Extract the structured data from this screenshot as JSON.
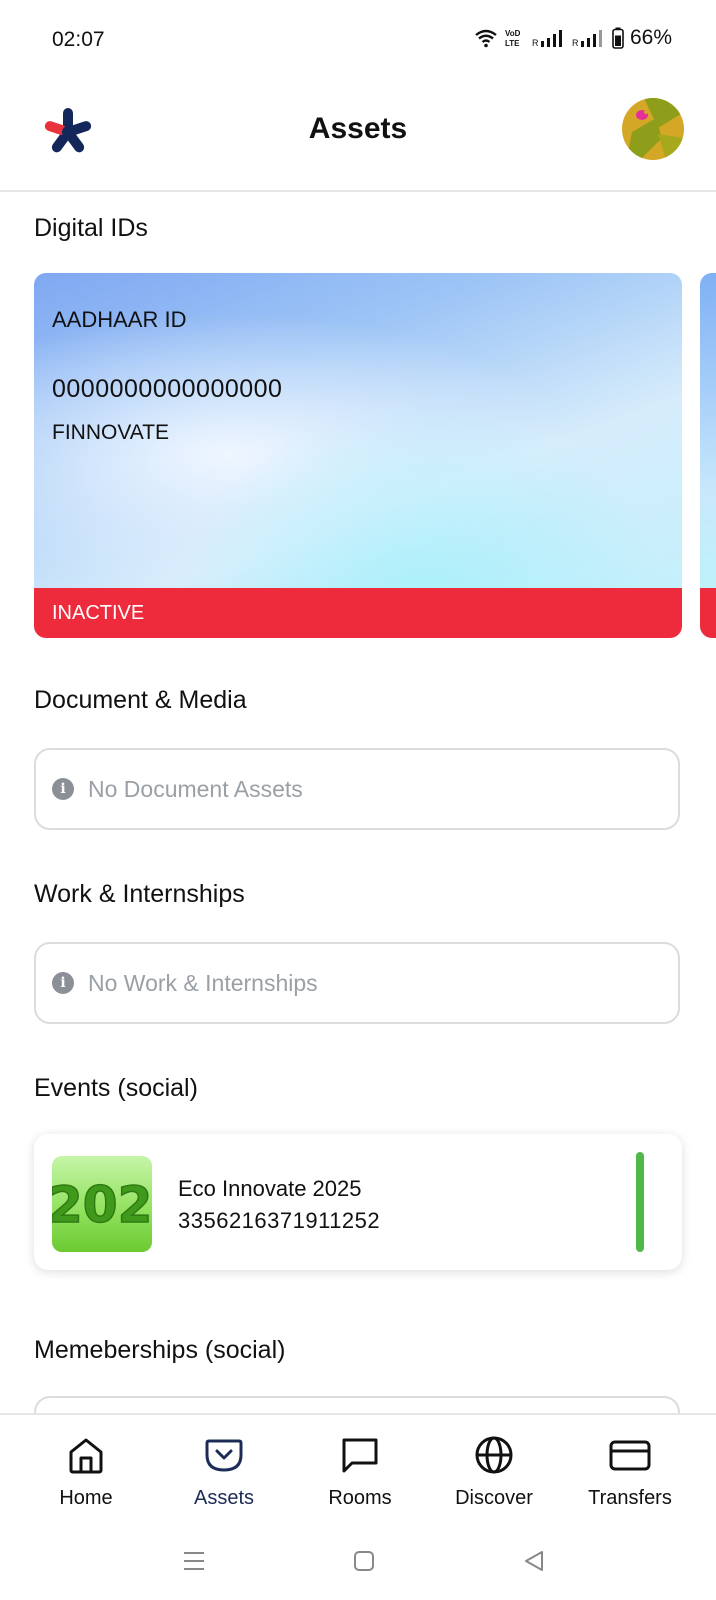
{
  "status_bar": {
    "time": "02:07",
    "battery": "66%",
    "icons": [
      "wifi-icon",
      "volte-icon",
      "signal-icon",
      "signal-icon",
      "battery-icon"
    ],
    "volte_label": "VoD\nLTE"
  },
  "header": {
    "title": "Assets",
    "logo_icon": "asterisk-logo-icon",
    "avatar_icon": "avatar-image"
  },
  "digital_ids": {
    "title": "Digital IDs",
    "cards": [
      {
        "type": "AADHAAR ID",
        "number": "0000000000000000",
        "issuer": "FINNOVATE",
        "status": "INACTIVE",
        "status_color": "#ee2b3c"
      }
    ]
  },
  "documents": {
    "title": "Document & Media",
    "empty_text": "No Document Assets",
    "icon": "info-icon"
  },
  "work": {
    "title": "Work & Internships",
    "empty_text": "No Work &  Internships",
    "icon": "info-icon"
  },
  "events": {
    "title": "Events (social)",
    "items": [
      {
        "name": "Eco Innovate 2025",
        "id": "3356216371911252",
        "status_color": "#4fb848"
      }
    ]
  },
  "memberships": {
    "title": "Memeberships (social)"
  },
  "bottom_nav": {
    "items": [
      {
        "label": "Home",
        "icon": "home-icon",
        "active": false
      },
      {
        "label": "Assets",
        "icon": "assets-icon",
        "active": true
      },
      {
        "label": "Rooms",
        "icon": "chat-icon",
        "active": false
      },
      {
        "label": "Discover",
        "icon": "globe-icon",
        "active": false
      },
      {
        "label": "Transfers",
        "icon": "card-icon",
        "active": false
      }
    ]
  },
  "system_nav": {
    "icons": [
      "menu-icon",
      "home-square-icon",
      "back-triangle-icon"
    ]
  },
  "colors": {
    "active_nav": "#1c2c56",
    "inactive_status": "#ee2b3c",
    "event_status": "#4fb848",
    "logo_navy": "#13275a",
    "logo_red": "#e8323c"
  }
}
